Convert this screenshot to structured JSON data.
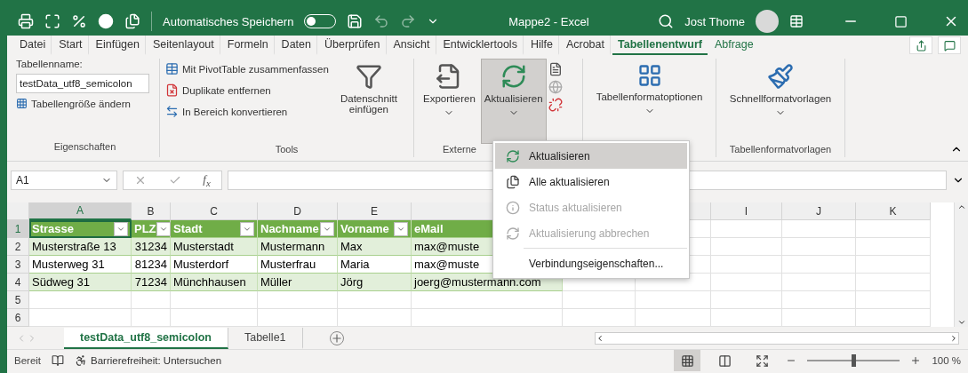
{
  "title_bar": {
    "autosave_label": "Automatisches Speichern",
    "autosave_on": false,
    "title": "Mappe2  -  Excel",
    "user": "Jost Thome"
  },
  "ribbon_tabs": [
    {
      "label": "Datei",
      "selected": false,
      "kind": "normal"
    },
    {
      "label": "Start",
      "selected": false,
      "kind": "normal"
    },
    {
      "label": "Einfügen",
      "selected": false,
      "kind": "normal"
    },
    {
      "label": "Seitenlayout",
      "selected": false,
      "kind": "normal"
    },
    {
      "label": "Formeln",
      "selected": false,
      "kind": "normal"
    },
    {
      "label": "Daten",
      "selected": false,
      "kind": "normal"
    },
    {
      "label": "Überprüfen",
      "selected": false,
      "kind": "normal"
    },
    {
      "label": "Ansicht",
      "selected": false,
      "kind": "normal"
    },
    {
      "label": "Entwicklertools",
      "selected": false,
      "kind": "normal"
    },
    {
      "label": "Hilfe",
      "selected": false,
      "kind": "normal"
    },
    {
      "label": "Acrobat",
      "selected": false,
      "kind": "normal"
    },
    {
      "label": "Tabellenentwurf",
      "selected": true,
      "kind": "contextual"
    },
    {
      "label": "Abfrage",
      "selected": false,
      "kind": "contextual"
    }
  ],
  "ribbon": {
    "properties": {
      "label": "Eigenschaften",
      "name_label": "Tabellenname:",
      "name_value": "testData_utf8_semicolon",
      "resize": "Tabellengröße ändern"
    },
    "tools": {
      "label": "Tools",
      "items": [
        "Mit PivotTable zusammenfassen",
        "Duplikate entfernen",
        "In Bereich konvertieren"
      ],
      "slicer": "Datenschnitt einfügen"
    },
    "external": {
      "label": "Externe",
      "buttons": [
        {
          "label": "Exportieren",
          "pressed": false
        },
        {
          "label": "Aktualisieren",
          "pressed": true
        }
      ]
    },
    "options": {
      "button": "Tabellenformatoptionen"
    },
    "styles": {
      "label": "Tabellenformatvorlagen",
      "button": "Schnellformatvorlagen"
    }
  },
  "refresh_menu": {
    "items": [
      {
        "label": "Aktualisieren",
        "selected": true,
        "disabled": false,
        "kind": "refresh"
      },
      {
        "label": "Alle aktualisieren",
        "selected": false,
        "disabled": false,
        "kind": "refresh_all"
      },
      {
        "label": "Status aktualisieren",
        "selected": false,
        "disabled": true,
        "kind": "info"
      },
      {
        "label": "Aktualisierung abbrechen",
        "selected": false,
        "disabled": true,
        "kind": "cancel"
      },
      {
        "label": "Verbindungseigenschaften...",
        "selected": false,
        "disabled": false,
        "kind": "plain"
      }
    ]
  },
  "formula_bar": {
    "name_box": "A1",
    "function_label": "f$_{x}$"
  },
  "sheet": {
    "columns": [
      {
        "letter": "A",
        "selected": true
      },
      {
        "letter": "B",
        "selected": false
      },
      {
        "letter": "C",
        "selected": false
      },
      {
        "letter": "D",
        "selected": false
      },
      {
        "letter": "E",
        "selected": false
      },
      {
        "letter": "I",
        "selected": false
      },
      {
        "letter": "J",
        "selected": false
      },
      {
        "letter": "K",
        "selected": false
      }
    ],
    "header_row": {
      "number": "1",
      "cells": [
        "Strasse",
        "PLZ",
        "Stadt",
        "Nachname",
        "Vorname",
        "eMail"
      ]
    },
    "rows": [
      {
        "number": "2",
        "cells": [
          "Musterstraße 13",
          "31234",
          "Musterstadt",
          "Mustermann",
          "Max",
          "max@muste"
        ]
      },
      {
        "number": "3",
        "cells": [
          "Musterweg 31",
          "81234",
          "Musterdorf",
          "Musterfrau",
          "Maria",
          "max@muste"
        ]
      },
      {
        "number": "4",
        "cells": [
          "Südweg 31",
          "71234",
          "Münchhausen",
          "Müller",
          "Jörg",
          "joerg@mustermann.com"
        ]
      },
      {
        "number": "5",
        "cells": []
      },
      {
        "number": "6",
        "cells": []
      }
    ]
  },
  "sheet_tabs": [
    {
      "label": "testData_utf8_semicolon",
      "selected": true
    },
    {
      "label": "Tabelle1",
      "selected": false
    }
  ],
  "status_bar": {
    "status": "Bereit",
    "accessibility": "Barrierefreiheit: Untersuchen",
    "views": [
      {
        "kind": "normal",
        "selected": true
      },
      {
        "kind": "page_layout",
        "selected": false
      },
      {
        "kind": "page_break",
        "selected": false
      }
    ],
    "zoom": {
      "level": 0.5,
      "reading": "100 %"
    }
  }
}
